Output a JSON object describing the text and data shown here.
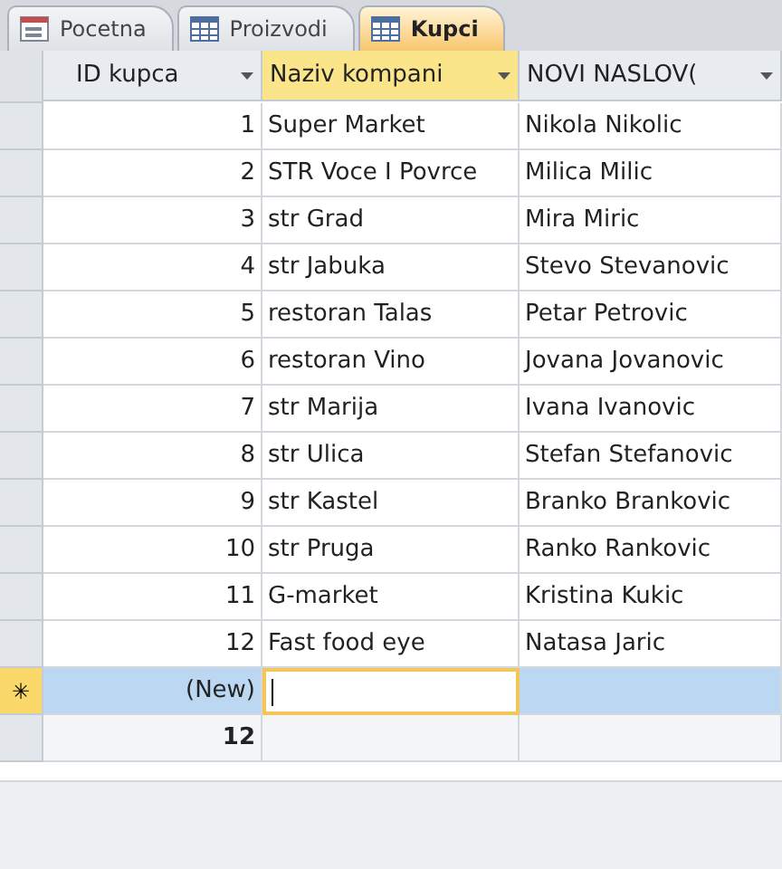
{
  "tabs": [
    {
      "label": "Pocetna",
      "kind": "form",
      "selected": false
    },
    {
      "label": "Proizvodi",
      "kind": "table",
      "selected": false
    },
    {
      "label": "Kupci",
      "kind": "table",
      "selected": true
    }
  ],
  "table": {
    "columns": [
      {
        "label": "ID kupca",
        "selected": false
      },
      {
        "label": "Naziv kompani",
        "selected": true
      },
      {
        "label": "NOVI NASLOV(",
        "selected": false
      }
    ],
    "rows": [
      [
        "1",
        "Super Market",
        "Nikola Nikolic"
      ],
      [
        "2",
        "STR Voce I Povrce",
        "Milica Milic"
      ],
      [
        "3",
        "str Grad",
        "Mira Miric"
      ],
      [
        "4",
        "str Jabuka",
        "Stevo Stevanovic"
      ],
      [
        "5",
        "restoran Talas",
        "Petar Petrovic"
      ],
      [
        "6",
        "restoran Vino",
        "Jovana Jovanovic"
      ],
      [
        "7",
        "str Marija",
        "Ivana Ivanovic"
      ],
      [
        "8",
        "str Ulica",
        "Stefan Stefanovic"
      ],
      [
        "9",
        "str Kastel",
        "Branko Brankovic"
      ],
      [
        "10",
        "str Pruga",
        "Ranko Rankovic"
      ],
      [
        "11",
        "G-market",
        "Kristina Kukic"
      ],
      [
        "12",
        "Fast food eye",
        "Natasa Jaric"
      ]
    ],
    "new_row": {
      "marker": "✳",
      "label": "(New)"
    },
    "totals": {
      "value": "12"
    }
  }
}
